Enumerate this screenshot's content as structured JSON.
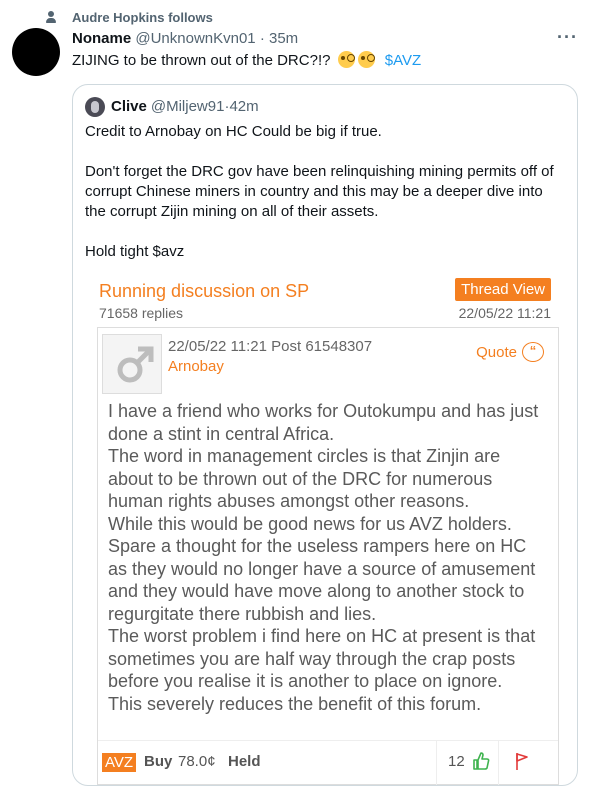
{
  "social_context": {
    "text": "Audre Hopkins follows"
  },
  "tweet": {
    "name": "Noname",
    "handle": "@UnknownKvn01",
    "separator": " · ",
    "time": "35m",
    "text": "ZIJING to be thrown out of the DRC?!?",
    "emojis": [
      "face-with-monocle",
      "face-with-monocle"
    ],
    "cashtag": "$AVZ",
    "more_label": "···"
  },
  "quoted": {
    "name": "Clive",
    "handle": "@Miljew91",
    "separator": " · ",
    "time": "42m",
    "paragraphs": [
      [
        "Credit to Arnobay on HC Could be big if true."
      ],
      [
        "Don't forget the DRC gov have been relinquishing mining permits off of",
        "corrupt Chinese miners in country and this may be a deeper dive into",
        "the corrupt Zijin mining on all of their assets."
      ],
      [
        "Hold tight $avz"
      ]
    ],
    "embed": {
      "title": "Running discussion on SP",
      "replies": "71658 replies",
      "thread_view_label": "Thread View",
      "date": "22/05/22 11:21",
      "post": {
        "meta": "22/05/22 11:21 Post  61548307",
        "author": "Arnobay",
        "quote_label": "Quote",
        "lines": [
          "I have a friend who works for Outokumpu and has just",
          "done a stint in central Africa.",
          "The word in management circles is that Zinjin are",
          "about to be thrown out of the DRC for numerous",
          "human rights abuses amongst other reasons.",
          "While this would be good news for us AVZ holders.",
          "Spare a thought for the useless rampers here on HC",
          "as they would no longer have a source of amusement",
          "and they would have move along to another stock to",
          "regurgitate there rubbish and lies.",
          "The worst problem i find here on HC at present is that",
          "sometimes you are half way through the crap posts",
          "before you realise it is another to place on ignore.",
          "This severely reduces the benefit of this forum."
        ],
        "footer": {
          "ticker": "AVZ",
          "sentiment": "Buy",
          "price": "78.0¢",
          "disclosure": "Held",
          "likes": "12"
        }
      }
    }
  },
  "colors": {
    "hc_orange": "#f47f20",
    "link_blue": "#1d9bf0",
    "muted": "#536471"
  }
}
